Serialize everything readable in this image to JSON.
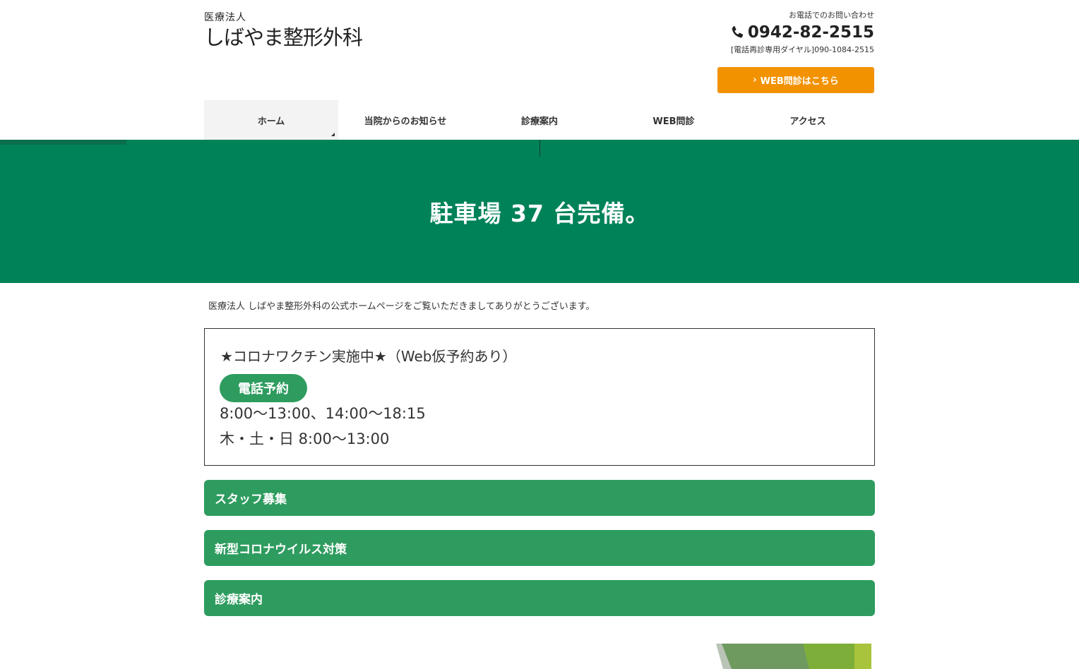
{
  "header": {
    "logo_sub": "医療法人",
    "logo_main": "しばやま整形外科",
    "contact_label": "お電話でのお問い合わせ",
    "phone": "0942-82-2515",
    "phone_sub": "[電話再診専用ダイヤル]090-1084-2515",
    "web_button": "WEB問診はこちら"
  },
  "nav": {
    "items": [
      "ホーム",
      "当院からのお知らせ",
      "診療案内",
      "WEB問診",
      "アクセス"
    ]
  },
  "hero": {
    "text": "駐車場 37 台完備。"
  },
  "main": {
    "intro": "医療法人 しばやま整形外科の公式ホームページをご覧いただきましてありがとうございます。",
    "notice": {
      "title": "★コロナワクチン実施中★（Web仮予約あり）",
      "badge": "電話予約",
      "hours1": "8:00～13:00、14:00～18:15",
      "hours2": "木・土・日 8:00～13:00"
    },
    "accordions": [
      "スタッフ募集",
      "新型コロナウイルス対策",
      "診療案内"
    ]
  },
  "colors": {
    "brand_green": "#008259",
    "accordion_green": "#2e9c5f",
    "orange": "#f39200"
  }
}
